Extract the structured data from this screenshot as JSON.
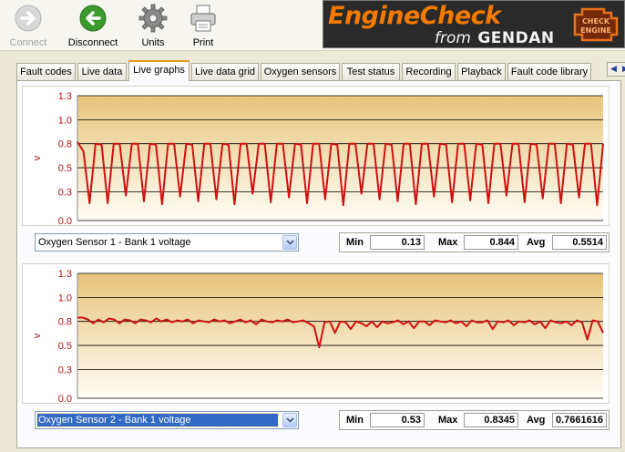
{
  "toolbar": {
    "connect": "Connect",
    "disconnect": "Disconnect",
    "units": "Units",
    "print": "Print"
  },
  "logo": {
    "title": "EngineCheck",
    "from": "from",
    "brand": "GENDAN",
    "badge_line1": "CHECK",
    "badge_line2": "ENGINE"
  },
  "tabs": [
    {
      "label": "Fault codes"
    },
    {
      "label": "Live data"
    },
    {
      "label": "Live graphs",
      "active": true
    },
    {
      "label": "Live data grid"
    },
    {
      "label": "Oxygen sensors"
    },
    {
      "label": "Test status"
    },
    {
      "label": "Recording"
    },
    {
      "label": "Playback"
    },
    {
      "label": "Fault code library"
    }
  ],
  "tab_scroll": {
    "left": "◀",
    "right": "▶"
  },
  "graphs": [
    {
      "sensor": "Oxygen Sensor 1 - Bank 1 voltage",
      "selected": false,
      "min_label": "Min",
      "min": "0.13",
      "max_label": "Max",
      "max": "0.844",
      "avg_label": "Avg",
      "avg": "0.5514"
    },
    {
      "sensor": "Oxygen Sensor 2 - Bank 1 voltage",
      "selected": true,
      "min_label": "Min",
      "min": "0.53",
      "max_label": "Max",
      "max": "0.8345",
      "avg_label": "Avg",
      "avg": "0.7661616"
    }
  ],
  "chart_data": [
    {
      "type": "line",
      "title": "",
      "xlabel": "",
      "ylabel": "v",
      "ylim": [
        0.0,
        1.3
      ],
      "yticks": [
        "1.3",
        "1.0",
        "0.8",
        "0.5",
        "0.3",
        "0.0"
      ],
      "ytick_values": [
        1.3,
        1.05,
        0.8,
        0.55,
        0.3,
        0.0
      ],
      "grid": true,
      "line_color": "#d01010",
      "series": [
        {
          "values": [
            0.82,
            0.72,
            0.18,
            0.8,
            0.79,
            0.18,
            0.8,
            0.8,
            0.26,
            0.8,
            0.8,
            0.2,
            0.8,
            0.79,
            0.17,
            0.8,
            0.8,
            0.25,
            0.8,
            0.79,
            0.2,
            0.8,
            0.8,
            0.22,
            0.8,
            0.79,
            0.17,
            0.8,
            0.8,
            0.28,
            0.8,
            0.8,
            0.19,
            0.8,
            0.8,
            0.24,
            0.8,
            0.79,
            0.18,
            0.8,
            0.8,
            0.22,
            0.8,
            0.79,
            0.16,
            0.8,
            0.8,
            0.28,
            0.8,
            0.8,
            0.22,
            0.8,
            0.79,
            0.2,
            0.8,
            0.8,
            0.17,
            0.8,
            0.8,
            0.25,
            0.8,
            0.79,
            0.19,
            0.8,
            0.8,
            0.21,
            0.8,
            0.79,
            0.18,
            0.8,
            0.8,
            0.26,
            0.8,
            0.8,
            0.19,
            0.8,
            0.79,
            0.23,
            0.8,
            0.8,
            0.18,
            0.8,
            0.79,
            0.24,
            0.8,
            0.8,
            0.16,
            0.8
          ]
        }
      ]
    },
    {
      "type": "line",
      "title": "",
      "xlabel": "",
      "ylabel": "v",
      "ylim": [
        0.0,
        1.3
      ],
      "yticks": [
        "1.3",
        "1.0",
        "0.8",
        "0.5",
        "0.3",
        "0.0"
      ],
      "ytick_values": [
        1.3,
        1.05,
        0.8,
        0.55,
        0.3,
        0.0
      ],
      "grid": true,
      "line_color": "#d01010",
      "series": [
        {
          "values": [
            0.84,
            0.84,
            0.82,
            0.78,
            0.82,
            0.79,
            0.83,
            0.82,
            0.78,
            0.82,
            0.81,
            0.78,
            0.82,
            0.81,
            0.79,
            0.83,
            0.8,
            0.82,
            0.79,
            0.81,
            0.8,
            0.82,
            0.78,
            0.81,
            0.8,
            0.79,
            0.82,
            0.8,
            0.81,
            0.78,
            0.8,
            0.82,
            0.79,
            0.81,
            0.77,
            0.82,
            0.8,
            0.79,
            0.81,
            0.8,
            0.82,
            0.79,
            0.8,
            0.81,
            0.78,
            0.75,
            0.53,
            0.79,
            0.8,
            0.68,
            0.8,
            0.79,
            0.72,
            0.8,
            0.78,
            0.75,
            0.8,
            0.74,
            0.8,
            0.78,
            0.79,
            0.81,
            0.77,
            0.8,
            0.73,
            0.8,
            0.8,
            0.76,
            0.81,
            0.8,
            0.79,
            0.81,
            0.78,
            0.8,
            0.75,
            0.81,
            0.79,
            0.79,
            0.81,
            0.72,
            0.8,
            0.79,
            0.81,
            0.76,
            0.8,
            0.79,
            0.81,
            0.77,
            0.8,
            0.73,
            0.81,
            0.79,
            0.78,
            0.8,
            0.76,
            0.81,
            0.79,
            0.61,
            0.81,
            0.8,
            0.68
          ]
        }
      ]
    }
  ]
}
